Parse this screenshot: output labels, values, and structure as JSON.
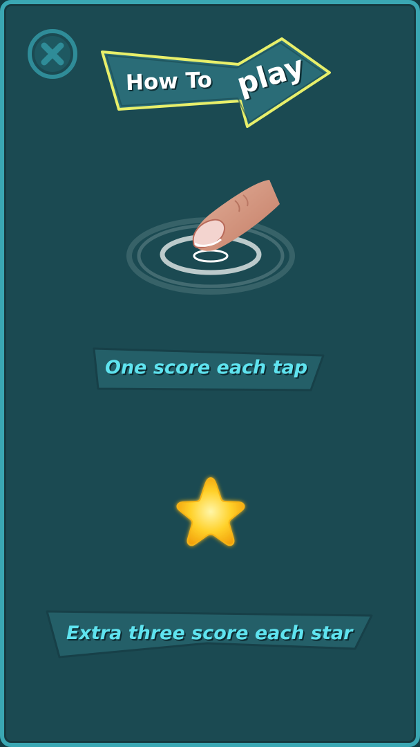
{
  "title": {
    "part1": "How To",
    "part2": "play"
  },
  "instructions": {
    "tap_label": "One score each tap",
    "star_label": "Extra three score each star"
  },
  "icons": {
    "close": "close-icon",
    "finger_tap": "finger-tap-icon",
    "star": "star-icon"
  },
  "colors": {
    "background": "#1b4a52",
    "border": "#3aa7b3",
    "label_text": "#5fe3ef",
    "title_outline": "#e8ef6a",
    "star": "#ffcc22"
  }
}
